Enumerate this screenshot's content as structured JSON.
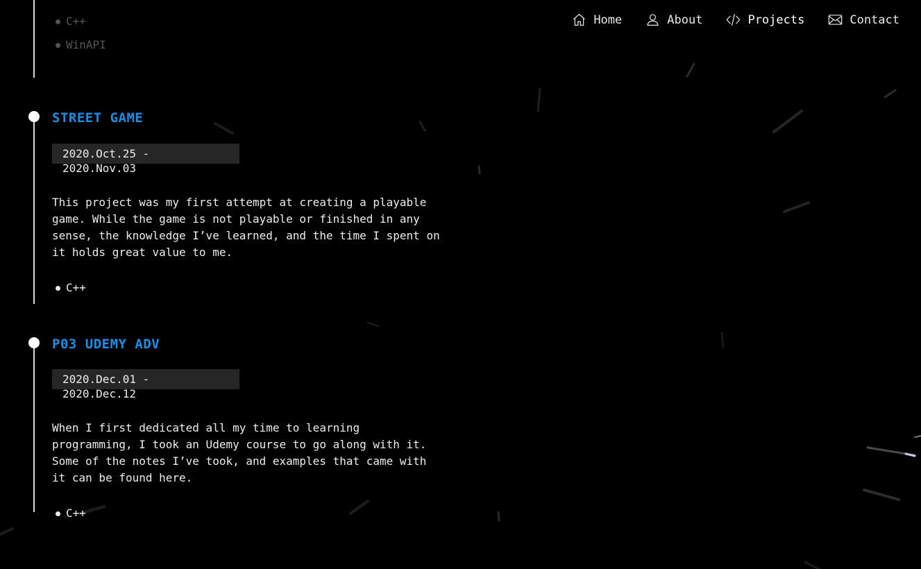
{
  "nav": {
    "items": [
      {
        "label": "Home",
        "icon": "home-icon"
      },
      {
        "label": "About",
        "icon": "user-icon"
      },
      {
        "label": "Projects",
        "icon": "code-icon",
        "active": true
      },
      {
        "label": "Contact",
        "icon": "mail-icon"
      }
    ]
  },
  "previous_entry": {
    "tags": [
      "C++",
      "WinAPI"
    ]
  },
  "projects": [
    {
      "title": "STREET GAME",
      "date": "2020.Oct.25 - 2020.Nov.03",
      "description": "This project was my first attempt at creating a playable game. While the game is not playable or finished in any sense, the knowledge I’ve learned, and the time I spent on it holds great value to me.",
      "tags": [
        "C++"
      ]
    },
    {
      "title": "P03 UDEMY ADV",
      "date": "2020.Dec.01 - 2020.Dec.12",
      "description_before_link": "When I first dedicated all my time to learning programming, I took an Udemy course to go along with it. Some of the notes I’ve took, and examples that came with it can be found ",
      "link_text": "here",
      "description_after_link": ".",
      "tags": [
        "C++"
      ]
    }
  ],
  "colors": {
    "background": "#000000",
    "title_accent": "#1b8fe6",
    "date_chip_bg": "#262626",
    "text": "#ededed"
  }
}
